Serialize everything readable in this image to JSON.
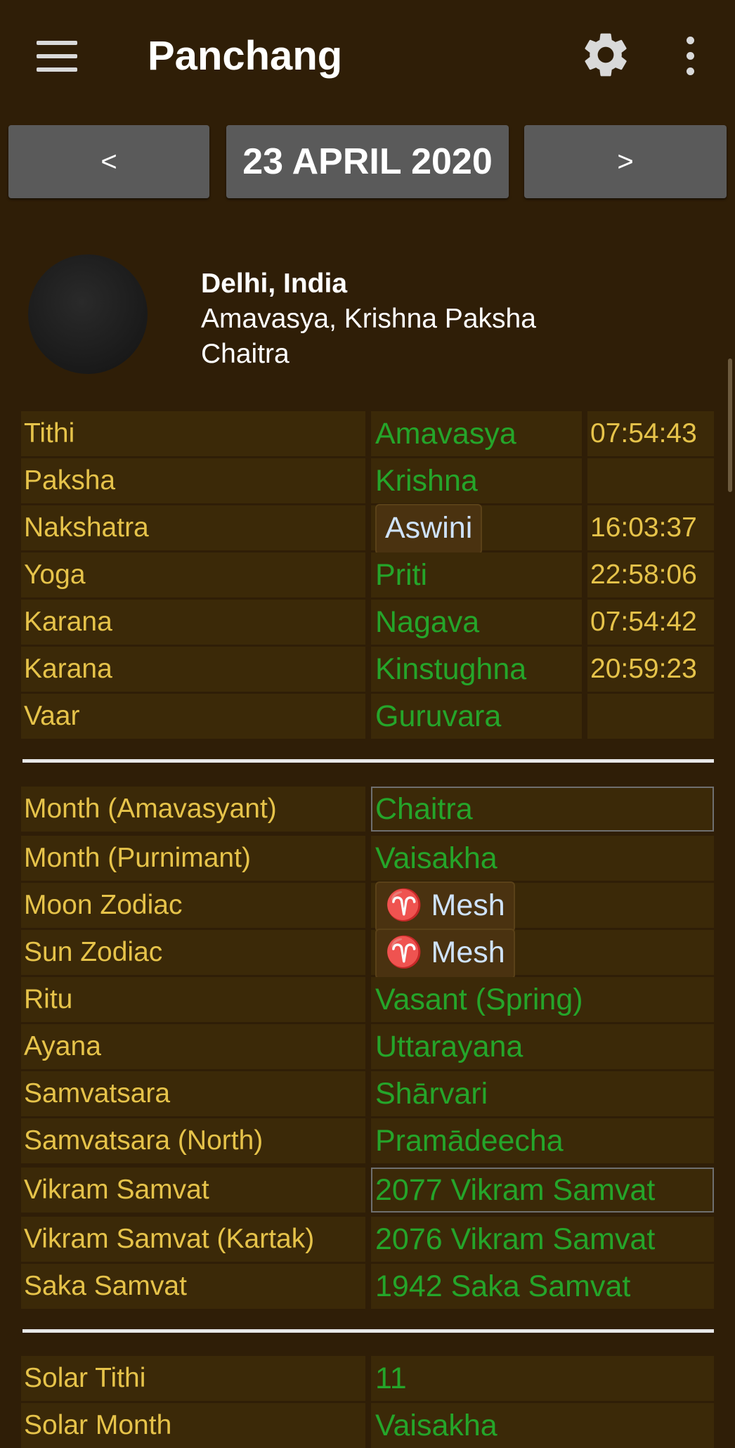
{
  "appbar": {
    "title": "Panchang",
    "menu_icon": "hamburger-menu-icon",
    "settings_icon": "gear-icon",
    "overflow_icon": "more-vert-icon"
  },
  "nav": {
    "prev_label": "<",
    "date_label": "23 APRIL 2020",
    "next_label": ">"
  },
  "location": {
    "name": "Delhi, India",
    "line2": "Amavasya, Krishna Paksha",
    "line3": "Chaitra"
  },
  "panchang": [
    {
      "label": "Tithi",
      "value": "Amavasya",
      "time": "07:54:43"
    },
    {
      "label": "Paksha",
      "value": "Krishna",
      "time": ""
    },
    {
      "label": "Nakshatra",
      "value": "Aswini",
      "time": "16:03:37"
    },
    {
      "label": "Yoga",
      "value": "Priti",
      "time": "22:58:06"
    },
    {
      "label": "Karana",
      "value": "Nagava",
      "time": "07:54:42"
    },
    {
      "label": "Karana",
      "value": "Kinstughna",
      "time": "20:59:23"
    },
    {
      "label": "Vaar",
      "value": "Guruvara",
      "time": ""
    }
  ],
  "calendar": [
    {
      "label": "Month (Amavasyant)",
      "value": "Chaitra"
    },
    {
      "label": "Month (Purnimant)",
      "value": "Vaisakha"
    },
    {
      "label": "Moon Zodiac",
      "symbol": "♈",
      "value": "Mesh"
    },
    {
      "label": "Sun Zodiac",
      "symbol": "♈",
      "value": "Mesh"
    },
    {
      "label": "Ritu",
      "value": "Vasant (Spring)"
    },
    {
      "label": "Ayana",
      "value": "Uttarayana"
    },
    {
      "label": "Samvatsara",
      "value": "Shārvari"
    },
    {
      "label": "Samvatsara (North)",
      "value": "Pramādeecha"
    },
    {
      "label": "Vikram Samvat",
      "value": "2077 Vikram Samvat"
    },
    {
      "label": "Vikram Samvat (Kartak)",
      "value": "2076 Vikram Samvat"
    },
    {
      "label": "Saka Samvat",
      "value": "1942 Saka Samvat"
    }
  ],
  "solar": [
    {
      "label": "Solar Tithi",
      "value": "11"
    },
    {
      "label": "Solar Month",
      "value": "Vaisakha"
    }
  ],
  "colors": {
    "background": "#2f1e07",
    "row_bg": "#3b2908",
    "label": "#e6c34a",
    "value": "#25a52a",
    "button": "#5a5a5a"
  }
}
